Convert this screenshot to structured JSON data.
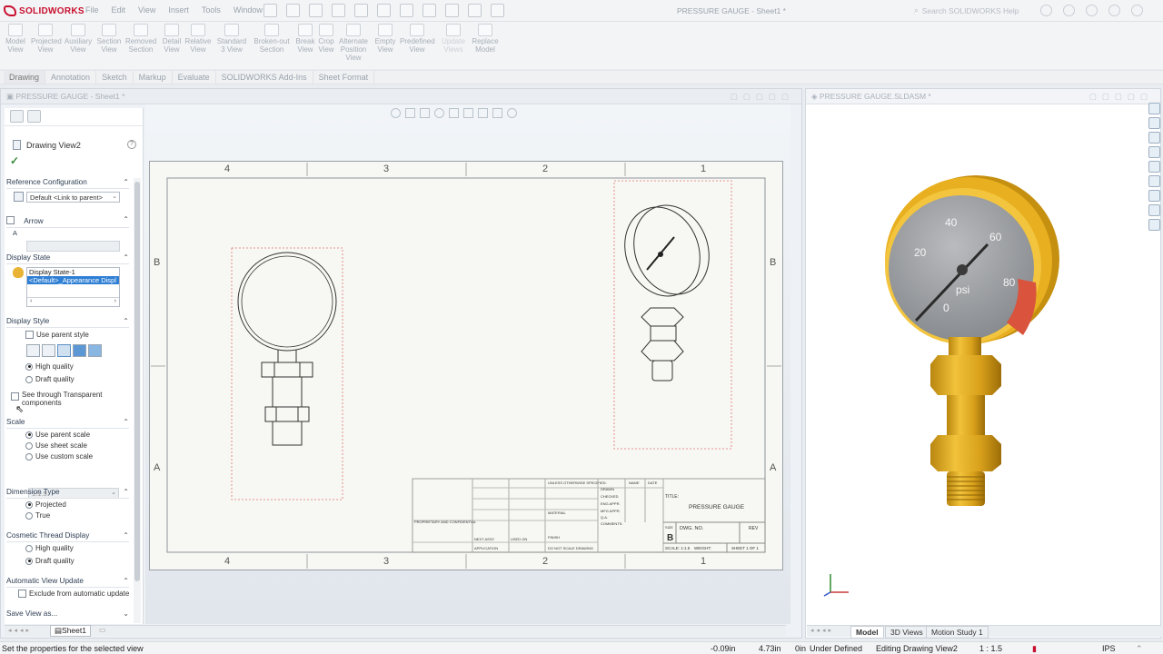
{
  "app": {
    "logo_text": "SOLIDWORKS",
    "document_title": "PRESSURE GAUGE - Sheet1 *",
    "search_placeholder": "Search SOLIDWORKS Help"
  },
  "menu": [
    "File",
    "Edit",
    "View",
    "Insert",
    "Tools",
    "Window"
  ],
  "ribbon": [
    {
      "l1": "Model",
      "l2": "View"
    },
    {
      "l1": "Projected",
      "l2": "View"
    },
    {
      "l1": "Auxiliary",
      "l2": "View"
    },
    {
      "l1": "Section",
      "l2": "View"
    },
    {
      "l1": "Removed",
      "l2": "Section"
    },
    {
      "l1": "Detail",
      "l2": "View"
    },
    {
      "l1": "Relative",
      "l2": "View"
    },
    {
      "l1": "Standard",
      "l2": "3 View"
    },
    {
      "l1": "Broken-out",
      "l2": "Section"
    },
    {
      "l1": "Break",
      "l2": "View"
    },
    {
      "l1": "Crop",
      "l2": "View"
    },
    {
      "l1": "Alternate",
      "l2": "Position View"
    },
    {
      "l1": "Empty",
      "l2": "View"
    },
    {
      "l1": "Predefined",
      "l2": "View"
    },
    {
      "l1": "Update",
      "l2": "Views"
    },
    {
      "l1": "Replace",
      "l2": "Model"
    }
  ],
  "cmd_tabs": [
    "Drawing",
    "Annotation",
    "Sketch",
    "Markup",
    "Evaluate",
    "SOLIDWORKS Add-Ins",
    "Sheet Format"
  ],
  "left_window": {
    "title": "PRESSURE GAUGE - Sheet1 *"
  },
  "right_window": {
    "title": "PRESSURE GAUGE.SLDASM *"
  },
  "panel": {
    "title": "Drawing View2",
    "help": "?",
    "reference_configuration": {
      "header": "Reference Configuration",
      "value": "Default <Link to parent>"
    },
    "arrow": {
      "header": "Arrow",
      "label_icon": "A"
    },
    "display_state": {
      "header": "Display State",
      "items": [
        "Display State-1",
        "<Default>_Appearance Displ"
      ]
    },
    "display_style": {
      "header": "Display Style",
      "use_parent": "Use parent style",
      "high_quality": "High quality",
      "draft_quality": "Draft quality",
      "see_through_1": "See through Transparent",
      "see_through_2": "components"
    },
    "scale": {
      "header": "Scale",
      "use_parent": "Use parent scale",
      "use_sheet": "Use sheet scale",
      "use_custom": "Use custom scale",
      "custom_value": "1:1.5"
    },
    "dimension_type": {
      "header": "Dimension Type",
      "projected": "Projected",
      "true": "True"
    },
    "cosmetic_thread": {
      "header": "Cosmetic Thread Display",
      "high": "High quality",
      "draft": "Draft quality"
    },
    "auto_update": {
      "header": "Automatic View Update",
      "exclude": "Exclude from automatic update"
    },
    "save_view": "Save View as..."
  },
  "sheet": {
    "zone_cols": [
      "4",
      "3",
      "2",
      "1"
    ],
    "zone_rows": [
      "B",
      "A"
    ],
    "title_block": {
      "title_label": "TITLE:",
      "title": "PRESSURE GAUGE",
      "size_label": "SIZE",
      "size": "B",
      "dwg_no": "DWG. NO.",
      "rev": "REV",
      "scale": "SCALE: 1:1.5",
      "weight": "WEIGHT:",
      "sheet": "SHEET 1 OF 1",
      "name": "NAME",
      "date": "DATE",
      "drawn": "DRAWN",
      "checked": "CHECKED",
      "eng_appr": "ENG APPR.",
      "mfg_appr": "MFG APPR.",
      "qa": "Q.A.",
      "comments": "COMMENTS:",
      "proprietary": "PROPRIETARY AND CONFIDENTIAL",
      "unless": "UNLESS OTHERWISE SPECIFIED:",
      "next_assy": "NEXT ASSY",
      "used_on": "USED ON",
      "application": "APPLICATION",
      "do_not_scale": "DO NOT SCALE DRAWING",
      "finish": "FINISH",
      "material": "MATERIAL"
    }
  },
  "gauge": {
    "ticks": [
      "0",
      "20",
      "40",
      "60",
      "80"
    ],
    "unit": "psi"
  },
  "sheet_tab": "Sheet1",
  "model_tabs": [
    "Model",
    "3D Views",
    "Motion Study 1"
  ],
  "status": {
    "message": "Set the properties for the selected view",
    "x": "-0.09in",
    "y": "4.73in",
    "z": "0in",
    "defined": "Under Defined",
    "editing": "Editing Drawing View2",
    "scale": "1 : 1.5",
    "units": "IPS"
  },
  "colors": {
    "gauge_body": "#e8b020",
    "gauge_face": "#9a9c9f",
    "red_zone": "#d9533d",
    "needle": "#2b2b2b",
    "accent": "#c8102e"
  }
}
